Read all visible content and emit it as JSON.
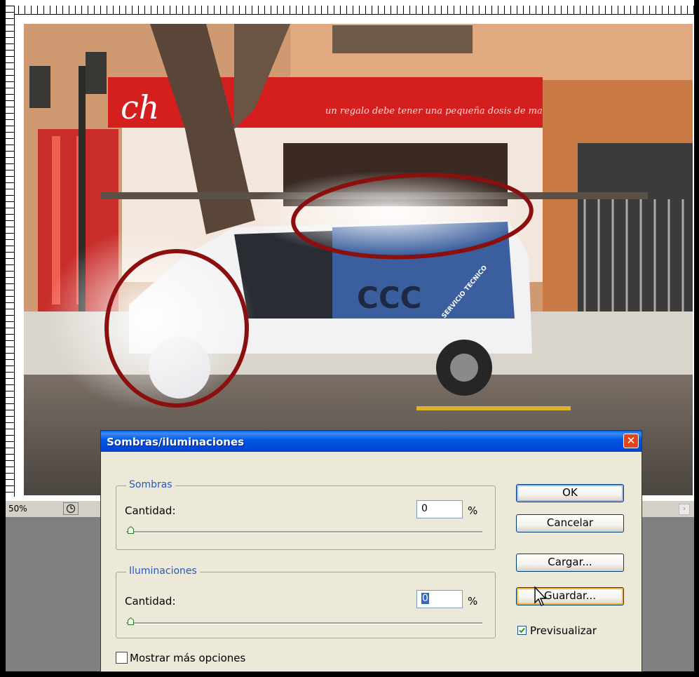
{
  "status_bar": {
    "zoom": "50%",
    "scroll_right_arrow": "›"
  },
  "photo": {
    "shop_slogan": "un regalo debe tener una pequeña dosis de magia...",
    "shop_sign": "ch",
    "van_logo": "CCC",
    "van_text": "SERVICIO TECNICO"
  },
  "dialog": {
    "title": "Sombras/iluminaciones",
    "close_glyph": "✕",
    "shadows": {
      "legend": "Sombras",
      "amount_label": "Cantidad:",
      "value": "0",
      "unit": "%",
      "slider_value": 0
    },
    "highlights": {
      "legend": "Iluminaciones",
      "amount_label": "Cantidad:",
      "value": "0",
      "unit": "%",
      "slider_value": 0
    },
    "buttons": {
      "ok": "OK",
      "cancel": "Cancelar",
      "load": "Cargar...",
      "save": "Guardar..."
    },
    "preview": {
      "label": "Previsualizar",
      "checked": true
    },
    "more_options": {
      "label": "Mostrar más opciones",
      "checked": false
    }
  },
  "colors": {
    "title_bar": "#0055e5",
    "dialog_bg": "#ece9d8",
    "accent_legend": "#2859c0",
    "annotation_ellipse": "#8b0f0f"
  }
}
